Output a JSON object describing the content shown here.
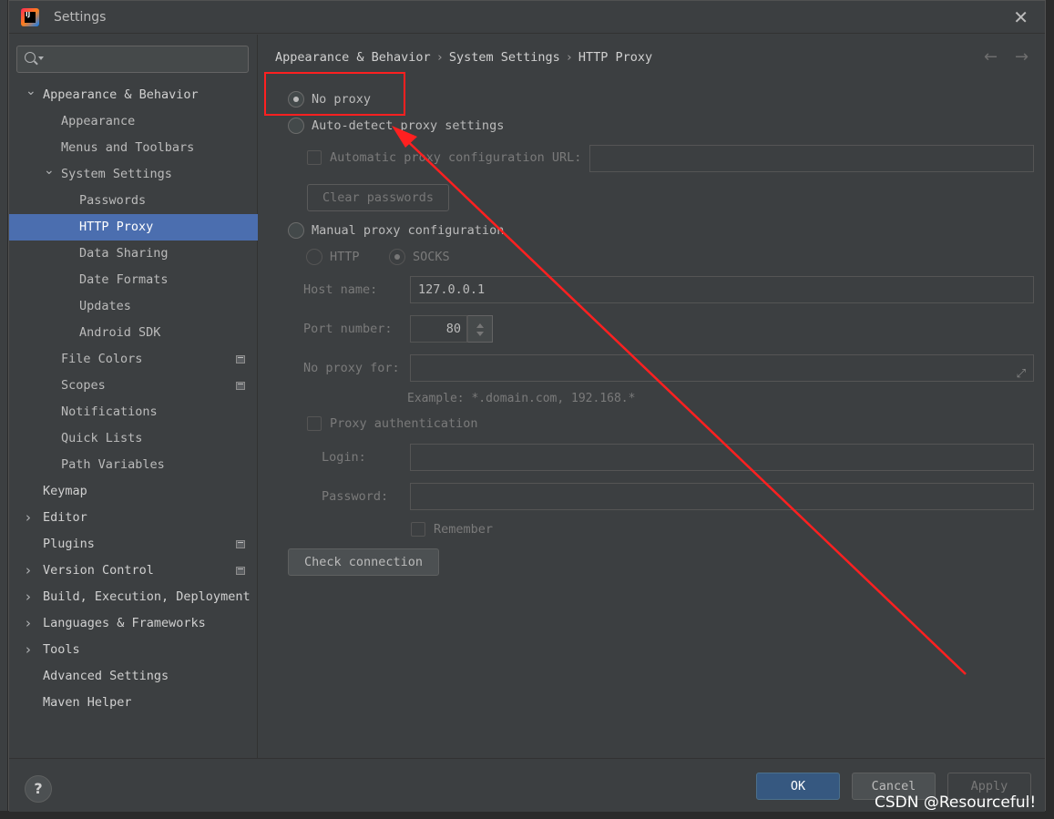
{
  "window": {
    "title": "Settings"
  },
  "search": {
    "placeholder": ""
  },
  "sidebar": {
    "items": [
      {
        "label": "Appearance & Behavior",
        "level": 0,
        "expanded": true,
        "bold": true
      },
      {
        "label": "Appearance",
        "level": 1
      },
      {
        "label": "Menus and Toolbars",
        "level": 1
      },
      {
        "label": "System Settings",
        "level": 1,
        "expanded": true
      },
      {
        "label": "Passwords",
        "level": 2
      },
      {
        "label": "HTTP Proxy",
        "level": 2,
        "selected": true
      },
      {
        "label": "Data Sharing",
        "level": 2
      },
      {
        "label": "Date Formats",
        "level": 2
      },
      {
        "label": "Updates",
        "level": 2
      },
      {
        "label": "Android SDK",
        "level": 2
      },
      {
        "label": "File Colors",
        "level": 1,
        "project": true
      },
      {
        "label": "Scopes",
        "level": 1,
        "project": true
      },
      {
        "label": "Notifications",
        "level": 1
      },
      {
        "label": "Quick Lists",
        "level": 1
      },
      {
        "label": "Path Variables",
        "level": 1
      },
      {
        "label": "Keymap",
        "level": 0,
        "bold": true
      },
      {
        "label": "Editor",
        "level": 0,
        "collapsed": true,
        "bold": true
      },
      {
        "label": "Plugins",
        "level": 0,
        "bold": true,
        "project": true
      },
      {
        "label": "Version Control",
        "level": 0,
        "collapsed": true,
        "bold": true,
        "project": true
      },
      {
        "label": "Build, Execution, Deployment",
        "level": 0,
        "collapsed": true,
        "bold": true
      },
      {
        "label": "Languages & Frameworks",
        "level": 0,
        "collapsed": true,
        "bold": true
      },
      {
        "label": "Tools",
        "level": 0,
        "collapsed": true,
        "bold": true
      },
      {
        "label": "Advanced Settings",
        "level": 0,
        "bold": true
      },
      {
        "label": "Maven Helper",
        "level": 0,
        "bold": true
      }
    ]
  },
  "breadcrumb": [
    "Appearance & Behavior",
    "System Settings",
    "HTTP Proxy"
  ],
  "breadcrumb_sep": "›",
  "nav": {
    "back_icon": "←",
    "forward_icon": "→"
  },
  "proxy": {
    "no_proxy": "No proxy",
    "auto_detect": "Auto-detect proxy settings",
    "auto_url_label": "Automatic proxy configuration URL:",
    "auto_url_value": "",
    "clear_passwords": "Clear passwords",
    "manual": "Manual proxy configuration",
    "http": "HTTP",
    "socks": "SOCKS",
    "host_label": "Host name:",
    "host_value": "127.0.0.1",
    "port_label": "Port number:",
    "port_value": "80",
    "noproxy_label": "No proxy for:",
    "noproxy_value": "",
    "example": "Example: *.domain.com, 192.168.*",
    "auth": "Proxy authentication",
    "login_label": "Login:",
    "login_value": "",
    "password_label": "Password:",
    "password_value": "",
    "remember": "Remember",
    "check_connection": "Check connection"
  },
  "footer": {
    "help": "?",
    "ok": "OK",
    "cancel": "Cancel",
    "apply": "Apply"
  },
  "watermark": "CSDN @Resourceful!",
  "colors": {
    "accent": "#4b6eaf",
    "annotation": "#ff2020",
    "primary_button": "#365880"
  }
}
